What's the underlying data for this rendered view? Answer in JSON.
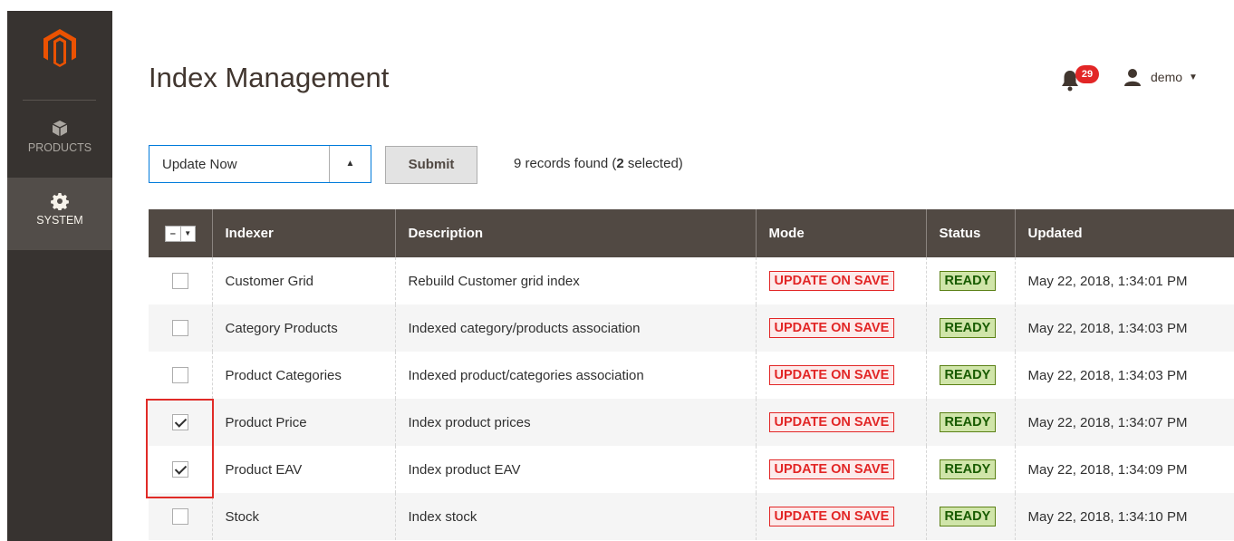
{
  "sidebar": {
    "items": [
      {
        "label": "PRODUCTS",
        "icon": "box-icon",
        "active": false
      },
      {
        "label": "SYSTEM",
        "icon": "gear-icon",
        "active": true
      }
    ]
  },
  "header": {
    "title": "Index Management",
    "notifications_count": "29",
    "user_name": "demo"
  },
  "toolbar": {
    "action_value": "Update Now",
    "submit_label": "Submit",
    "records_prefix": "9 records found (",
    "records_selected": "2",
    "records_suffix": " selected)"
  },
  "grid": {
    "columns": [
      "Indexer",
      "Description",
      "Mode",
      "Status",
      "Updated"
    ],
    "mass_select_symbol": "–",
    "rows": [
      {
        "checked": false,
        "indexer": "Customer Grid",
        "description": "Rebuild Customer grid index",
        "mode": "UPDATE ON SAVE",
        "status": "READY",
        "updated": "May 22, 2018, 1:34:01 PM"
      },
      {
        "checked": false,
        "indexer": "Category Products",
        "description": "Indexed category/products association",
        "mode": "UPDATE ON SAVE",
        "status": "READY",
        "updated": "May 22, 2018, 1:34:03 PM"
      },
      {
        "checked": false,
        "indexer": "Product Categories",
        "description": "Indexed product/categories association",
        "mode": "UPDATE ON SAVE",
        "status": "READY",
        "updated": "May 22, 2018, 1:34:03 PM"
      },
      {
        "checked": true,
        "indexer": "Product Price",
        "description": "Index product prices",
        "mode": "UPDATE ON SAVE",
        "status": "READY",
        "updated": "May 22, 2018, 1:34:07 PM"
      },
      {
        "checked": true,
        "indexer": "Product EAV",
        "description": "Index product EAV",
        "mode": "UPDATE ON SAVE",
        "status": "READY",
        "updated": "May 22, 2018, 1:34:09 PM"
      },
      {
        "checked": false,
        "indexer": "Stock",
        "description": "Index stock",
        "mode": "UPDATE ON SAVE",
        "status": "READY",
        "updated": "May 22, 2018, 1:34:10 PM"
      }
    ]
  },
  "colors": {
    "sidebar_bg": "#373330",
    "header_row_bg": "#514943",
    "mode_red": "#e22626",
    "ready_green": "#185b00",
    "logo_orange": "#eb5202"
  }
}
